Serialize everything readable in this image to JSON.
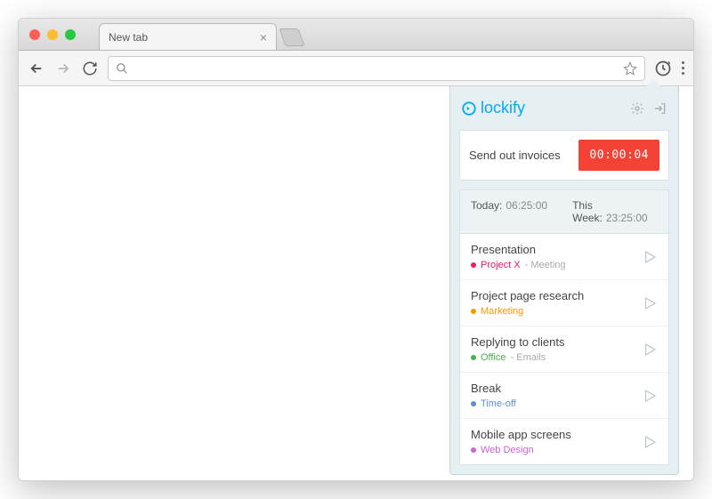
{
  "browser": {
    "tab_title": "New tab"
  },
  "popup": {
    "brand": "lockify",
    "timer": {
      "task": "Send out invoices",
      "elapsed": "00:00:04",
      "running_color": "#f44336"
    },
    "totals": {
      "today_label": "Today:",
      "today_value": "06:25:00",
      "week_label": "This Week:",
      "week_value": "23:25:00"
    },
    "entries": [
      {
        "title": "Presentation",
        "project": "Project X",
        "project_color": "#e91e63",
        "tag": "Meeting"
      },
      {
        "title": "Project page research",
        "project": "Marketing",
        "project_color": "#ff9800",
        "tag": ""
      },
      {
        "title": "Replying to clients",
        "project": "Office",
        "project_color": "#4caf50",
        "tag": "Emails"
      },
      {
        "title": "Break",
        "project": "Time-off",
        "project_color": "#5c8ed6",
        "tag": ""
      },
      {
        "title": "Mobile app screens",
        "project": "Web Design",
        "project_color": "#d060d8",
        "tag": ""
      }
    ]
  }
}
